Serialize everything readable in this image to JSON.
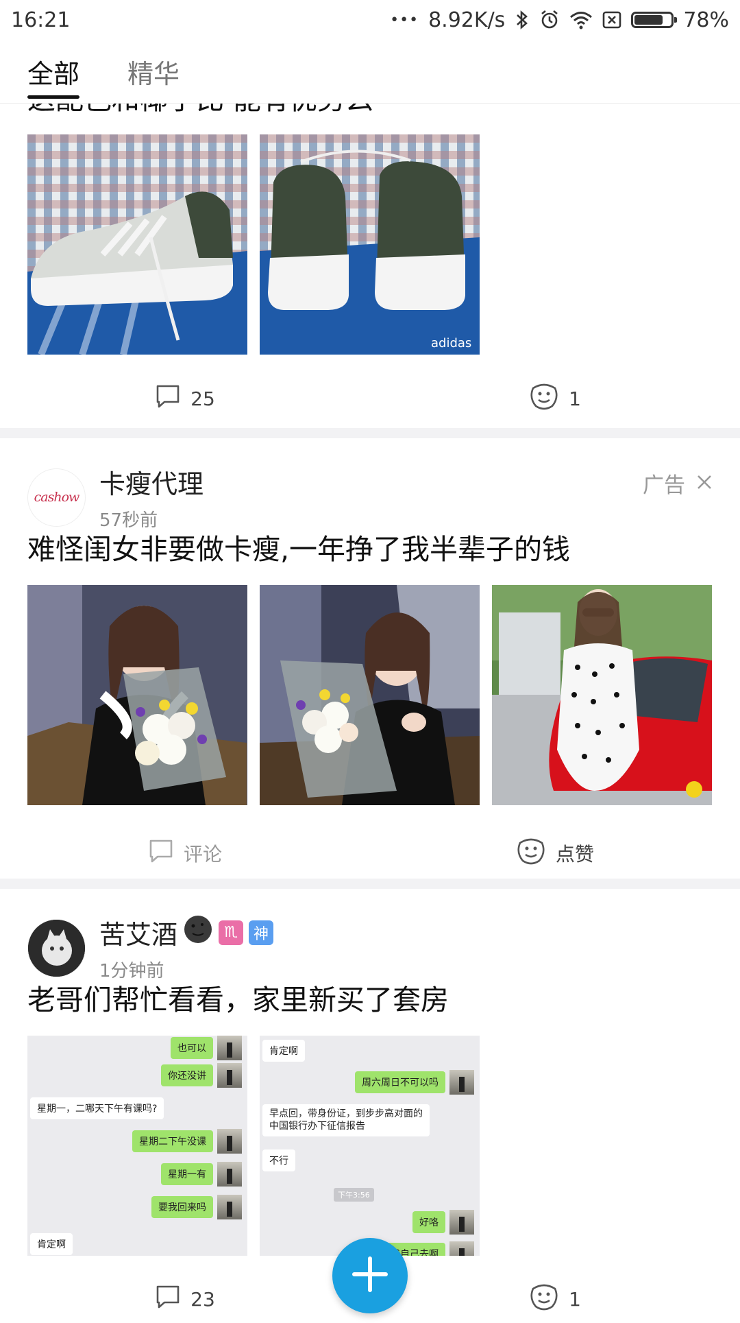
{
  "status_bar": {
    "time": "16:21",
    "dots": "•••",
    "network_speed": "8.92K/s",
    "battery_percent": "78%",
    "battery_level": 0.78
  },
  "tabs": [
    {
      "label": "全部",
      "active": true
    },
    {
      "label": "精华",
      "active": false
    }
  ],
  "posts": [
    {
      "title": "这配色和椰子比 能有优势么",
      "comment_count": "25",
      "like_count": "1"
    },
    {
      "author": "卡瘦代理",
      "avatar_text": "cashow",
      "time": "57秒前",
      "ad_label": "广告",
      "title": "难怪闺女非要做卡瘦,一年挣了我半辈子的钱",
      "comment_label": "评论",
      "like_label": "点赞"
    },
    {
      "author": "苦艾酒",
      "badges": [
        "♏",
        "神"
      ],
      "time": "1分钟前",
      "title": "老哥们帮忙看看，家里新买了套房",
      "comment_count": "23",
      "like_count": "1",
      "chat_left": [
        "也可以",
        "你还没讲",
        "星期一，二哪天下午有课吗?",
        "星期二下午没课",
        "星期一有",
        "要我回来吗",
        "肯定啊"
      ],
      "chat_right": [
        "肯定啊",
        "周六周日不可以吗",
        "早点回，带身份证，到步步高对面的",
        "中国银行办下征信报告",
        "不行",
        "下午3:56",
        "好咯",
        "我自己去啊"
      ]
    }
  ],
  "colors": {
    "accent": "#1aa0e0",
    "separator": "#f2f2f4"
  }
}
